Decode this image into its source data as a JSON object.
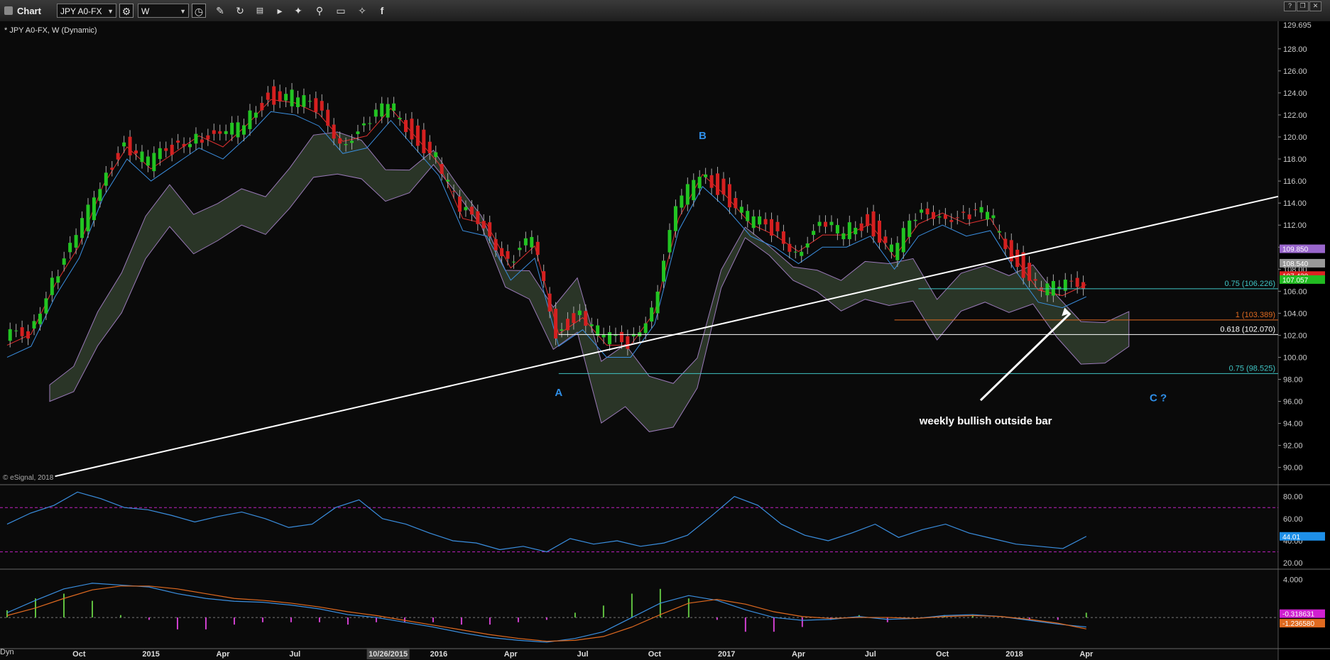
{
  "toolbar": {
    "app_title": "Chart",
    "symbol": "JPY A0-FX",
    "interval": "W"
  },
  "bottom_label": "Dyn",
  "chart_data": {
    "type": "candlestick",
    "title": "* JPY A0-FX, W (Dynamic)",
    "copyright": "© eSignal, 2018",
    "ylim": [
      88.5,
      130.5
    ],
    "yticks": [
      "90.00",
      "92.00",
      "94.00",
      "96.00",
      "98.00",
      "100.00",
      "102.00",
      "104.00",
      "106.00",
      "108.00",
      "110.00",
      "112.00",
      "114.00",
      "116.00",
      "118.00",
      "120.00",
      "122.00",
      "124.00",
      "126.00",
      "128.00"
    ],
    "top_price_label": "129.695",
    "x_labels": [
      "Oct",
      "2015",
      "Apr",
      "Jul",
      "10/26/2015",
      "2016",
      "Apr",
      "Jul",
      "Oct",
      "2017",
      "Apr",
      "Jul",
      "Oct",
      "2018",
      "Apr"
    ],
    "price_tags": [
      {
        "value": 109.85,
        "text": "109.850",
        "color": "#9966cc"
      },
      {
        "value": 108.54,
        "text": "108.540",
        "color": "#999999"
      },
      {
        "value": 107.42,
        "text": "107.420",
        "color": "#dd2222"
      },
      {
        "value": 107.057,
        "text": "107.057",
        "color": "#22bb22"
      }
    ],
    "fib_levels": [
      {
        "value": 106.226,
        "text": "0.75 (106.226)",
        "color": "#3fc4c4",
        "start": "2017-09"
      },
      {
        "value": 103.389,
        "text": "1 (103.389)",
        "color": "#e06a20",
        "start": "2017-08"
      },
      {
        "value": 102.07,
        "text": "0.618 (102.070)",
        "color": "#ffffff",
        "start": "2016-06"
      },
      {
        "value": 98.525,
        "text": "0.75 (98.525)",
        "color": "#3fc4c4",
        "start": "2016-06"
      }
    ],
    "wave_labels": [
      {
        "text": "A",
        "date": "2016-06",
        "value": 96.5
      },
      {
        "text": "B",
        "date": "2016-12",
        "value": 119.8
      },
      {
        "text": "C ?",
        "date": "2018-07",
        "value": 96.0
      }
    ],
    "annotation": {
      "text": "weekly bullish outside bar",
      "date": "2017-12",
      "value": 93.9
    },
    "trendline": {
      "start": {
        "date": "2014-09",
        "value": 89.2
      },
      "end": {
        "date": "2018-12",
        "value": 114.6
      }
    },
    "ohlc_points": [
      [
        "2014-07",
        101.5
      ],
      [
        "2014-08",
        102.5
      ],
      [
        "2014-09",
        107.0
      ],
      [
        "2014-10",
        110.5
      ],
      [
        "2014-11",
        116.0
      ],
      [
        "2014-12",
        119.5
      ],
      [
        "2015-01",
        117.5
      ],
      [
        "2015-02",
        119.0
      ],
      [
        "2015-03",
        120.5
      ],
      [
        "2015-04",
        119.5
      ],
      [
        "2015-05",
        121.5
      ],
      [
        "2015-06",
        123.8
      ],
      [
        "2015-07",
        123.5
      ],
      [
        "2015-08",
        122.5
      ],
      [
        "2015-09",
        120.0
      ],
      [
        "2015-10",
        120.5
      ],
      [
        "2015-11",
        123.0
      ],
      [
        "2015-12",
        120.5
      ],
      [
        "2016-01",
        118.0
      ],
      [
        "2016-02",
        113.0
      ],
      [
        "2016-03",
        112.5
      ],
      [
        "2016-04",
        108.5
      ],
      [
        "2016-05",
        110.5
      ],
      [
        "2016-06",
        102.5
      ],
      [
        "2016-07",
        104.0
      ],
      [
        "2016-08",
        101.5
      ],
      [
        "2016-09",
        101.5
      ],
      [
        "2016-10",
        104.5
      ],
      [
        "2016-11",
        113.0
      ],
      [
        "2016-12",
        117.0
      ],
      [
        "2017-01",
        115.0
      ],
      [
        "2017-02",
        112.5
      ],
      [
        "2017-03",
        111.5
      ],
      [
        "2017-04",
        110.0
      ],
      [
        "2017-05",
        111.5
      ],
      [
        "2017-06",
        111.5
      ],
      [
        "2017-07",
        112.5
      ],
      [
        "2017-08",
        109.5
      ],
      [
        "2017-09",
        112.5
      ],
      [
        "2017-10",
        113.5
      ],
      [
        "2017-11",
        112.5
      ],
      [
        "2017-12",
        113.0
      ],
      [
        "2018-01",
        109.5
      ],
      [
        "2018-02",
        106.5
      ],
      [
        "2018-03",
        106.0
      ],
      [
        "2018-04",
        107.0
      ]
    ],
    "indicator_rsi": {
      "ylim": [
        15,
        90
      ],
      "yticks": [
        "20.00",
        "40.00",
        "60.00",
        "80.00"
      ],
      "levels": [
        30,
        70
      ],
      "last_label": "44.01",
      "values": [
        55,
        65,
        72,
        84,
        78,
        70,
        68,
        63,
        57,
        62,
        66,
        60,
        52,
        55,
        70,
        77,
        60,
        55,
        47,
        40,
        38,
        32,
        35,
        30,
        42,
        37,
        40,
        35,
        38,
        45,
        62,
        80,
        72,
        55,
        45,
        40,
        47,
        55,
        43,
        50,
        55,
        47,
        42,
        37,
        35,
        33,
        44
      ]
    },
    "indicator_macd": {
      "ylim": [
        -3.2,
        5.0
      ],
      "yticks": [
        "4.000"
      ],
      "zero": 0,
      "macd_label": "-0.318631",
      "signal_label": "-1.236580",
      "macd": [
        0.5,
        1.8,
        3.0,
        3.6,
        3.4,
        3.2,
        2.5,
        2.0,
        1.7,
        1.6,
        1.3,
        0.9,
        0.3,
        0.0,
        -0.5,
        -1.0,
        -1.6,
        -2.1,
        -2.4,
        -2.6,
        -2.2,
        -1.5,
        0.0,
        1.5,
        2.3,
        1.8,
        0.8,
        0.0,
        -0.3,
        -0.2,
        0.1,
        -0.2,
        -0.1,
        0.2,
        0.3,
        0.1,
        -0.3,
        -0.7,
        -1.0
      ],
      "signal": [
        0.2,
        1.0,
        2.0,
        2.9,
        3.3,
        3.3,
        3.0,
        2.5,
        2.0,
        1.8,
        1.5,
        1.1,
        0.6,
        0.2,
        -0.3,
        -0.8,
        -1.3,
        -1.8,
        -2.2,
        -2.5,
        -2.4,
        -2.0,
        -1.0,
        0.3,
        1.5,
        1.9,
        1.4,
        0.6,
        0.1,
        -0.1,
        0.0,
        0.0,
        -0.1,
        0.1,
        0.2,
        0.1,
        -0.2,
        -0.6,
        -1.2
      ]
    }
  }
}
